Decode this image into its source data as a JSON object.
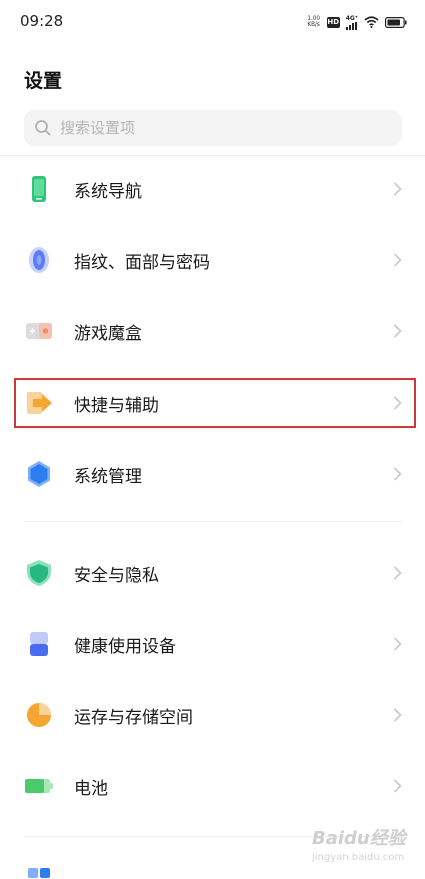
{
  "status_bar": {
    "time": "09:28",
    "net_speed_value": "1.00",
    "net_speed_unit": "KB/s",
    "hd_label": "HD",
    "signal_label": "4G⁺"
  },
  "page_title": "设置",
  "search": {
    "placeholder": "搜索设置项"
  },
  "items": [
    {
      "label": "系统导航",
      "icon": "phone-navigation-icon",
      "color": "#2fc47a"
    },
    {
      "label": "指纹、面部与密码",
      "icon": "fingerprint-icon",
      "color": "#5b7cf6"
    },
    {
      "label": "游戏魔盒",
      "icon": "game-box-icon",
      "color": "#f08a6a"
    },
    {
      "label": "快捷与辅助",
      "icon": "shortcut-arrow-icon",
      "color": "#f7a531"
    },
    {
      "label": "系统管理",
      "icon": "hexagon-system-icon",
      "color": "#2d7cf0"
    },
    {
      "label": "安全与隐私",
      "icon": "shield-icon",
      "color": "#27b87f"
    },
    {
      "label": "健康使用设备",
      "icon": "hourglass-icon",
      "color": "#4a6cf0"
    },
    {
      "label": "运存与存储空间",
      "icon": "pie-chart-icon",
      "color": "#f7a531"
    },
    {
      "label": "电池",
      "icon": "battery-icon",
      "color": "#4cc96a"
    }
  ],
  "highlight_item": "快捷与辅助",
  "watermark": {
    "text": "Baidu经验",
    "sub": "jingyan.baidu.com"
  }
}
